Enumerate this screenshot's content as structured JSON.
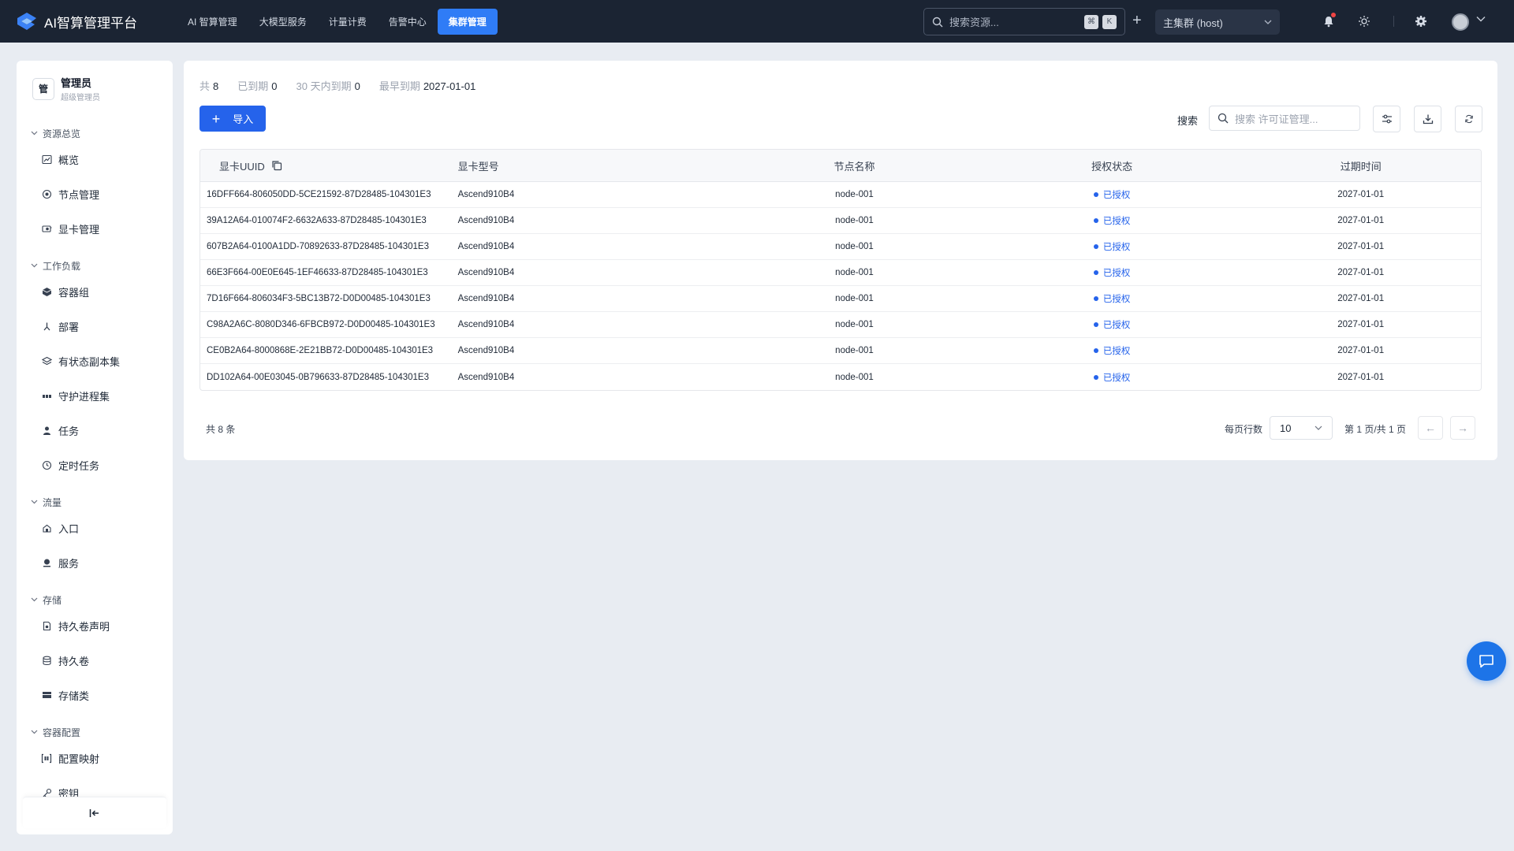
{
  "app": {
    "title": "AI智算管理平台",
    "nav": [
      {
        "label": "AI 智算管理",
        "active": false
      },
      {
        "label": "大模型服务",
        "active": false
      },
      {
        "label": "计量计费",
        "active": false
      },
      {
        "label": "告警中心",
        "active": false
      },
      {
        "label": "集群管理",
        "active": true
      }
    ],
    "search_placeholder": "搜索资源...",
    "shortcut_keys": [
      "⌘",
      "K"
    ],
    "cluster": "主集群 (host)"
  },
  "sidebar": {
    "user_initial": "管",
    "user_name": "管理员",
    "user_role": "超级管理员",
    "groups": [
      {
        "title": "资源总览",
        "items": [
          {
            "label": "概览",
            "icon": "chart-icon"
          },
          {
            "label": "节点管理",
            "icon": "node-icon"
          },
          {
            "label": "显卡管理",
            "icon": "gpu-icon"
          }
        ]
      },
      {
        "title": "工作负载",
        "items": [
          {
            "label": "容器组",
            "icon": "cube-icon"
          },
          {
            "label": "部署",
            "icon": "deploy-icon"
          },
          {
            "label": "有状态副本集",
            "icon": "layers-icon"
          },
          {
            "label": "守护进程集",
            "icon": "daemon-icon"
          },
          {
            "label": "任务",
            "icon": "task-icon"
          },
          {
            "label": "定时任务",
            "icon": "clock-icon"
          }
        ]
      },
      {
        "title": "流量",
        "items": [
          {
            "label": "入口",
            "icon": "ingress-icon"
          },
          {
            "label": "服务",
            "icon": "service-icon"
          }
        ]
      },
      {
        "title": "存储",
        "items": [
          {
            "label": "持久卷声明",
            "icon": "pvc-icon"
          },
          {
            "label": "持久卷",
            "icon": "database-icon"
          },
          {
            "label": "存储类",
            "icon": "storage-icon"
          }
        ]
      },
      {
        "title": "容器配置",
        "items": [
          {
            "label": "配置映射",
            "icon": "configmap-icon"
          },
          {
            "label": "密钥",
            "icon": "key-icon"
          }
        ]
      }
    ]
  },
  "stats": [
    {
      "label": "共",
      "value": "8"
    },
    {
      "label": "已到期",
      "value": "0"
    },
    {
      "label": "30 天内到期",
      "value": "0"
    },
    {
      "label": "最早到期",
      "value": "2027-01-01"
    }
  ],
  "toolbar": {
    "import_label": "导入",
    "search_label": "搜索",
    "search_placeholder": "搜索 许可证管理..."
  },
  "table": {
    "columns": [
      "显卡UUID",
      "显卡型号",
      "节点名称",
      "授权状态",
      "过期时间"
    ],
    "rows": [
      {
        "uuid": "16DFF664-806050DD-5CE21592-87D28485-104301E3",
        "model": "Ascend910B4",
        "node": "node-001",
        "status": "已授权",
        "expires": "2027-01-01"
      },
      {
        "uuid": "39A12A64-010074F2-6632A633-87D28485-104301E3",
        "model": "Ascend910B4",
        "node": "node-001",
        "status": "已授权",
        "expires": "2027-01-01"
      },
      {
        "uuid": "607B2A64-0100A1DD-70892633-87D28485-104301E3",
        "model": "Ascend910B4",
        "node": "node-001",
        "status": "已授权",
        "expires": "2027-01-01"
      },
      {
        "uuid": "66E3F664-00E0E645-1EF46633-87D28485-104301E3",
        "model": "Ascend910B4",
        "node": "node-001",
        "status": "已授权",
        "expires": "2027-01-01"
      },
      {
        "uuid": "7D16F664-806034F3-5BC13B72-D0D00485-104301E3",
        "model": "Ascend910B4",
        "node": "node-001",
        "status": "已授权",
        "expires": "2027-01-01"
      },
      {
        "uuid": "C98A2A6C-8080D346-6FBCB972-D0D00485-104301E3",
        "model": "Ascend910B4",
        "node": "node-001",
        "status": "已授权",
        "expires": "2027-01-01"
      },
      {
        "uuid": "CE0B2A64-8000868E-2E21BB72-D0D00485-104301E3",
        "model": "Ascend910B4",
        "node": "node-001",
        "status": "已授权",
        "expires": "2027-01-01"
      },
      {
        "uuid": "DD102A64-00E03045-0B796633-87D28485-104301E3",
        "model": "Ascend910B4",
        "node": "node-001",
        "status": "已授权",
        "expires": "2027-01-01"
      }
    ]
  },
  "pagination": {
    "total_text": "共 8 条",
    "per_page_label": "每页行数",
    "per_page_value": "10",
    "page_info": "第 1 页/共 1 页",
    "prev": "←",
    "next": "→"
  },
  "colors": {
    "topbar": "#1b2433",
    "accent": "#2563eb",
    "authorized": "#2563eb"
  }
}
